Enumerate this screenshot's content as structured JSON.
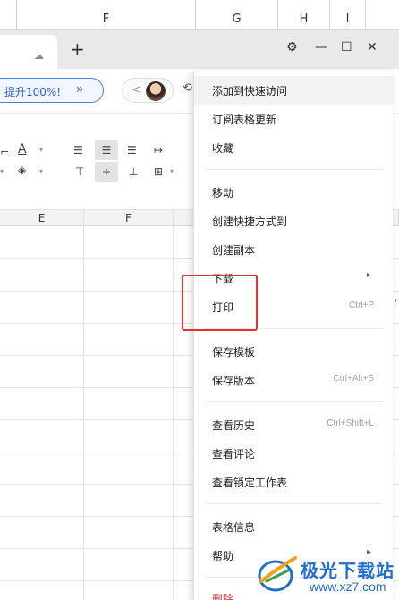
{
  "background_sheet": {
    "columns": [
      "F",
      "G",
      "H",
      "I"
    ]
  },
  "window": {
    "new_tab_label": "+",
    "icons": {
      "cloud": "cloud-icon",
      "settings": "gear-icon",
      "minimize": "minimize-icon",
      "maximize": "maximize-icon",
      "close": "close-icon"
    }
  },
  "address_bar": {
    "promo_text": "提升100%!",
    "promo_arrow": "»",
    "back_chevron": "<"
  },
  "grid": {
    "columns": [
      "E",
      "F"
    ]
  },
  "menu": {
    "items": [
      {
        "label": "添加到快速访问",
        "shortcut": "",
        "submenu": false
      },
      {
        "label": "订阅表格更新",
        "shortcut": "",
        "submenu": false
      },
      {
        "label": "收藏",
        "shortcut": "",
        "submenu": false
      },
      {
        "label": "移动",
        "shortcut": "",
        "submenu": false
      },
      {
        "label": "创建快捷方式到",
        "shortcut": "",
        "submenu": false
      },
      {
        "label": "创建副本",
        "shortcut": "",
        "submenu": false
      },
      {
        "label": "下载",
        "shortcut": "",
        "submenu": true
      },
      {
        "label": "打印",
        "shortcut": "Ctrl+P",
        "submenu": false
      },
      {
        "label": "保存模板",
        "shortcut": "",
        "submenu": false
      },
      {
        "label": "保存版本",
        "shortcut": "Ctrl+Alt+S",
        "submenu": false
      },
      {
        "label": "查看历史",
        "shortcut": "Ctrl+Shift+L",
        "submenu": false
      },
      {
        "label": "查看评论",
        "shortcut": "",
        "submenu": false
      },
      {
        "label": "查看锁定工作表",
        "shortcut": "",
        "submenu": false
      },
      {
        "label": "表格信息",
        "shortcut": "",
        "submenu": false
      },
      {
        "label": "帮助",
        "shortcut": "",
        "submenu": true
      },
      {
        "label": "删除",
        "shortcut": "",
        "submenu": false
      }
    ],
    "submenu_arrow": "▸"
  },
  "highlight": {
    "color": "#e0322f"
  },
  "watermark": {
    "title": "极光下载站",
    "url": "www.xz7.com"
  }
}
